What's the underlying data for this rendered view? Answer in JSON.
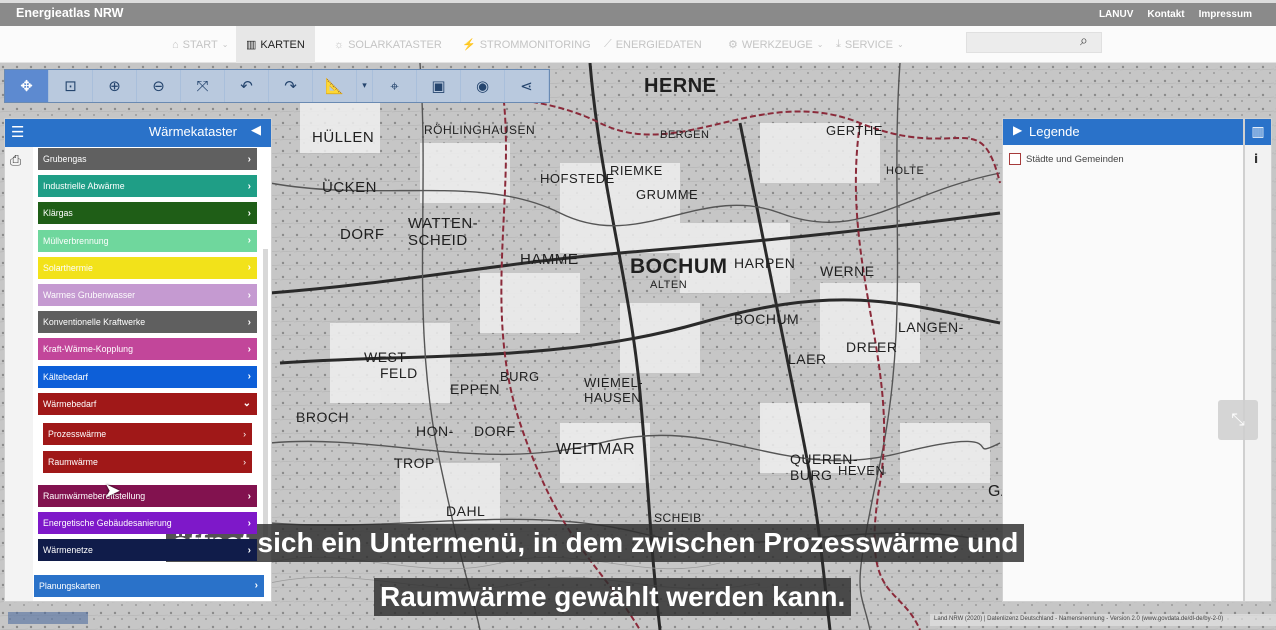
{
  "app": {
    "title": "Energieatlas NRW"
  },
  "top_links": [
    "LANUV",
    "Kontakt",
    "Impressum"
  ],
  "nav": [
    {
      "label": "START",
      "icon": "home-icon",
      "active": false
    },
    {
      "label": "KARTEN",
      "icon": "map-icon",
      "active": true
    },
    {
      "label": "SOLARKATASTER",
      "icon": "sun-icon",
      "active": false
    },
    {
      "label": "STROMMONITORING",
      "icon": "plug-icon",
      "active": false
    },
    {
      "label": "ENERGIEDATEN",
      "icon": "chart-icon",
      "active": false
    },
    {
      "label": "WERKZEUGE",
      "icon": "cogs-icon",
      "active": false
    },
    {
      "label": "SERVICE",
      "icon": "download-icon",
      "active": false
    }
  ],
  "search": {
    "placeholder": ""
  },
  "panel": {
    "title": "Wärmekataster"
  },
  "layers": [
    {
      "label": "Grubengas",
      "color": "#606060"
    },
    {
      "label": "Industrielle Abwärme",
      "color": "#1f9e86"
    },
    {
      "label": "Klärgas",
      "color": "#1f5e17"
    },
    {
      "label": "Müllverbrennung",
      "color": "#6fd79d"
    },
    {
      "label": "Solarthermie",
      "color": "#f2e21a"
    },
    {
      "label": "Warmes Grubenwasser",
      "color": "#c59ad1"
    },
    {
      "label": "Konventionelle Kraftwerke",
      "color": "#5f5f5f"
    },
    {
      "label": "Kraft-Wärme-Kopplung",
      "color": "#c2469a"
    },
    {
      "label": "Kältebedarf",
      "color": "#0d5fd8"
    },
    {
      "label": "Wärmebedarf",
      "color": "#a01818"
    }
  ],
  "sublayers": [
    {
      "label": "Prozesswärme",
      "color": "#a01818"
    },
    {
      "label": "Raumwärme",
      "color": "#a01818"
    }
  ],
  "layers_after": [
    {
      "label": "Raumwärmebereitstellung",
      "color": "#82124f"
    },
    {
      "label": "Energetische Gebäudesanierung",
      "color": "#7e18c9"
    },
    {
      "label": "Wärmenetze",
      "color": "#101c4a"
    }
  ],
  "planning": {
    "label": "Planungskarten",
    "color": "#2a72c9"
  },
  "legend": {
    "title": "Legende",
    "item": "Städte und Gemeinden"
  },
  "map_places": [
    "HERNE",
    "BOCHUM",
    "HÜLLEN",
    "RÖHLINGHAUSEN",
    "HOFSTEDE",
    "RIEMKE",
    "GRUMME",
    "GERTHE",
    "HOLTE",
    "ÜCKEN",
    "DORF",
    "WATTEN-SCHEID",
    "HAMME",
    "HARPEN",
    "WERNE",
    "ALTEN",
    "BOCHUM",
    "LANGEN-",
    "LAER",
    "DREER",
    "WEST",
    "FELD",
    "EPPEN",
    "BURG",
    "WIEMEL-HAUSEN",
    "BROCH",
    "HON-",
    "DORF",
    "TROP",
    "WEITMAR",
    "QUEREN-BURG",
    "HEVEN",
    "SCHEIB",
    "DAHL",
    "BERGEN",
    "GARTEN"
  ],
  "caption_lines": [
    "öffnet sich ein Untermenü, in dem zwischen Prozesswärme und",
    "Raumwärme gewählt werden kann."
  ],
  "copyright": "Land NRW (2020) | Datenlizenz Deutschland - Namensnennung - Version 2.0 (www.govdata.de/dl-de/by-2-0)"
}
